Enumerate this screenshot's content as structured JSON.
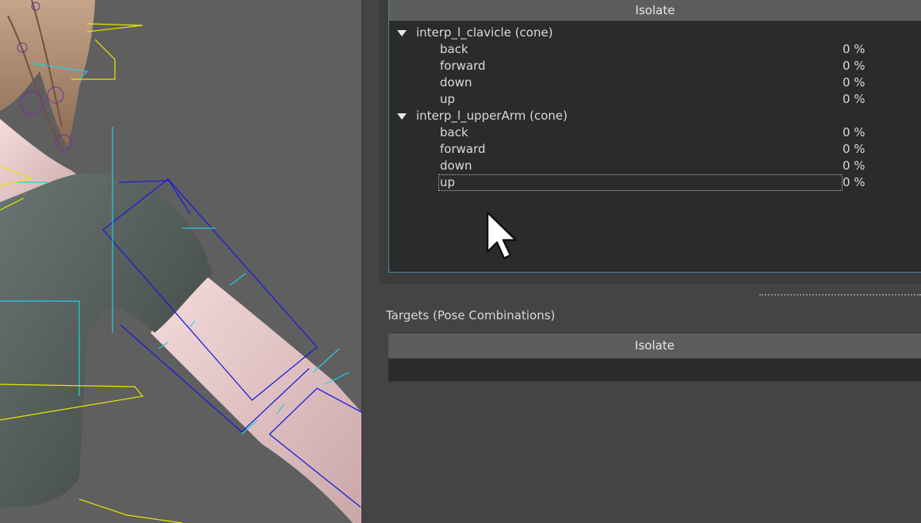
{
  "panel": {
    "upper_header": "Isolate",
    "groups": [
      {
        "label": "interp_l_clavicle (cone)",
        "children": [
          {
            "label": "back",
            "value": "0 %"
          },
          {
            "label": "forward",
            "value": "0 %"
          },
          {
            "label": "down",
            "value": "0 %"
          },
          {
            "label": "up",
            "value": "0 %"
          }
        ]
      },
      {
        "label": "interp_l_upperArm (cone)",
        "children": [
          {
            "label": "back",
            "value": "0 %"
          },
          {
            "label": "forward",
            "value": "0 %"
          },
          {
            "label": "down",
            "value": "0 %"
          },
          {
            "label": "up",
            "value": "0 %"
          }
        ]
      }
    ],
    "targets_label": "Targets (Pose Combinations)",
    "targets_header": "Isolate"
  },
  "colors": {
    "viewport_bg": "#5f5f5f",
    "panel_bg": "#444444",
    "tree_bg": "#2b2b2b",
    "header_bg": "#5d5d5d",
    "selection_border": "#5285a6",
    "wire_blue": "#1c1cd8",
    "wire_cyan": "#20d0e0",
    "wire_yellow": "#e6e600"
  },
  "icons": {
    "expand": "triangle-down-icon",
    "cursor": "mouse-pointer-icon"
  }
}
